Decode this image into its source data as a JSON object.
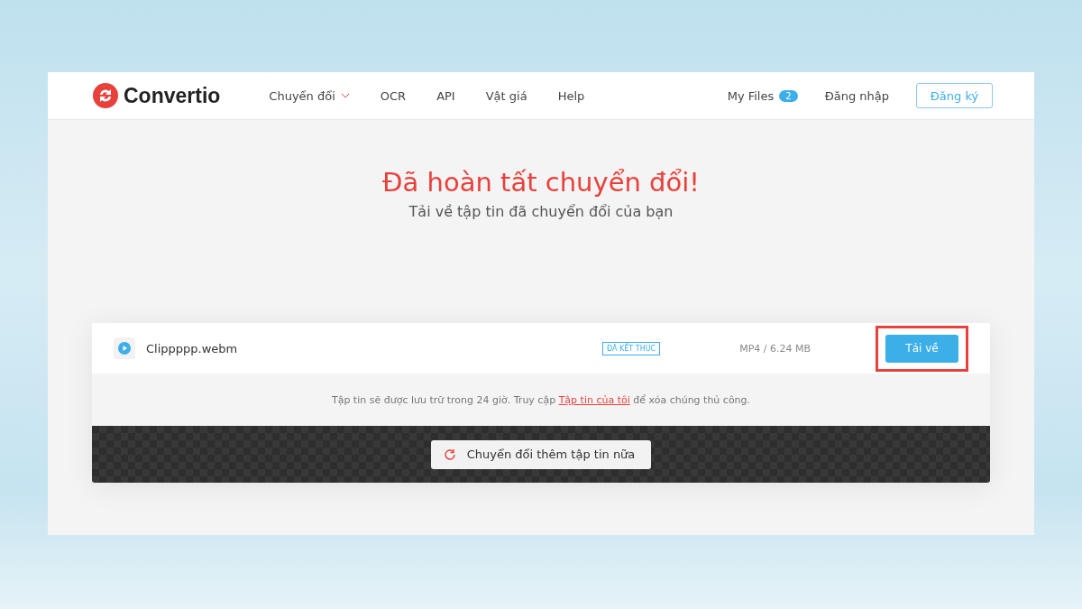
{
  "logo": {
    "name": "Convertio"
  },
  "nav": [
    {
      "label": "Chuyển đổi",
      "kind": "dropdown"
    },
    {
      "label": "OCR",
      "kind": "link"
    },
    {
      "label": "API",
      "kind": "link"
    },
    {
      "label": "Vật giá",
      "kind": "link"
    },
    {
      "label": "Help",
      "kind": "link"
    }
  ],
  "account": {
    "my_files": "My Files",
    "file_count": "2",
    "login": "Đăng nhập",
    "signup": "Đăng ký"
  },
  "hero": {
    "title": "Đã hoàn tất chuyển đổi!",
    "subtitle": "Tải về tập tin đã chuyển đổi của bạn"
  },
  "files": [
    {
      "name": "Clippppp.webm",
      "status": "ĐÃ KẾT THÚC",
      "info": "MP4 / 6.24 MB",
      "download": "Tải về",
      "highlighted": true
    }
  ],
  "notice": {
    "text": "Tập tin sẽ được lưu trữ trong 24 giờ. Truy cập ",
    "link": "Tập tin của tôi",
    "after": " để xóa chúng thủ công."
  },
  "convert_more": "Chuyển đổi thêm tập tin nữa"
}
